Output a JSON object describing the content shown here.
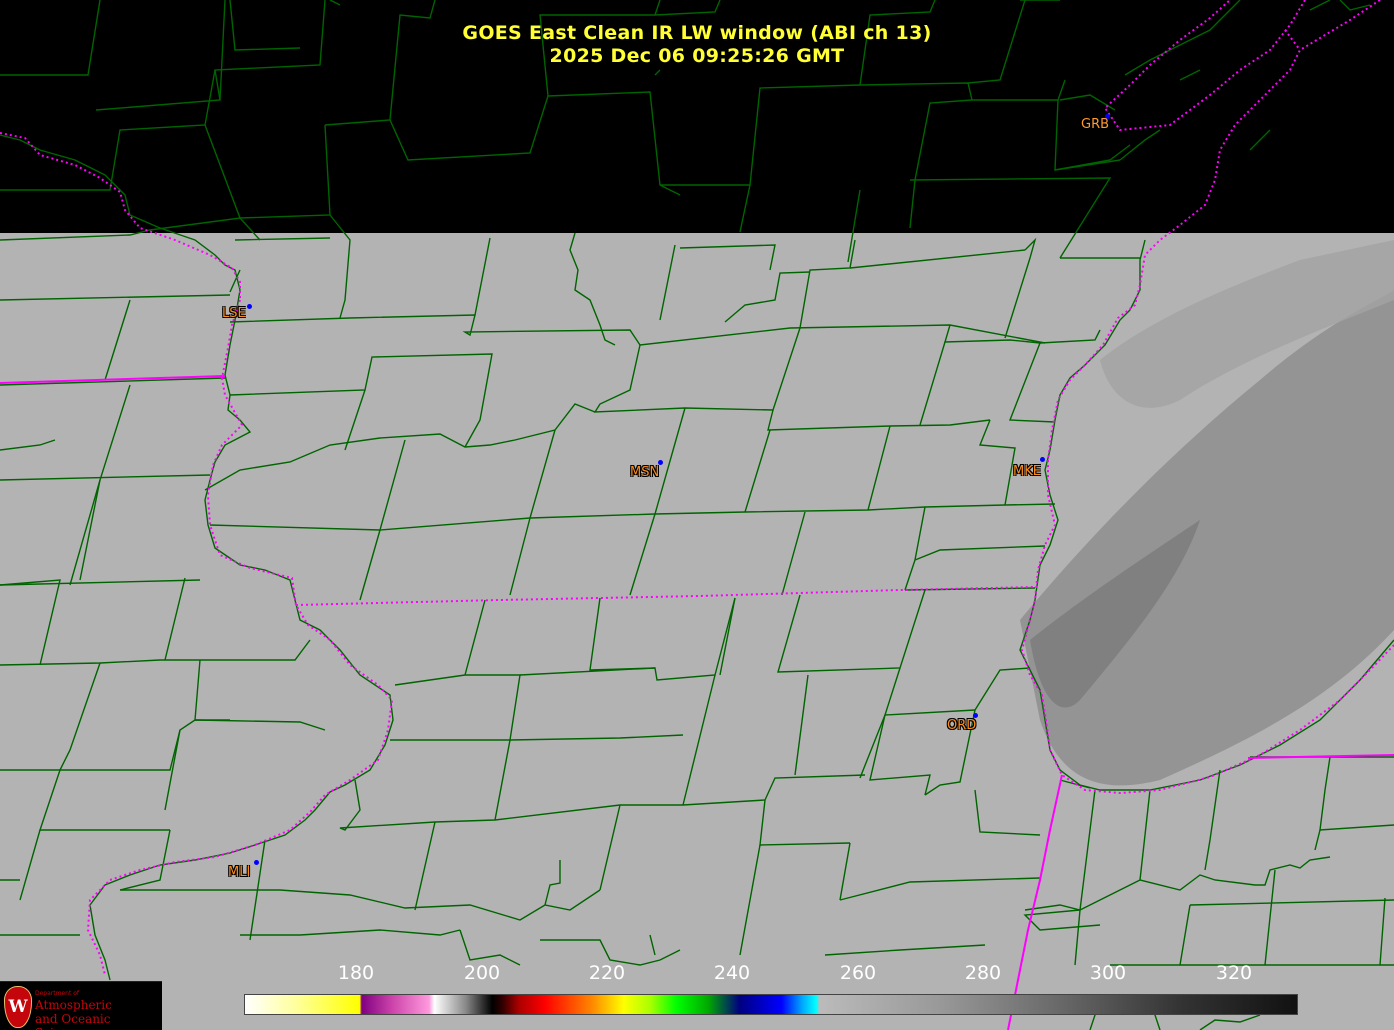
{
  "title": {
    "line1": "GOES East Clean IR LW window (ABI ch 13)",
    "line2": "2025 Dec 06  09:25:26 GMT"
  },
  "stations": [
    {
      "code": "GRB",
      "boxed": false
    },
    {
      "code": "LSE",
      "boxed": true
    },
    {
      "code": "MSN",
      "boxed": true
    },
    {
      "code": "MKE",
      "boxed": true
    },
    {
      "code": "ORD",
      "boxed": true
    },
    {
      "code": "MLI",
      "boxed": true
    }
  ],
  "colorbar": {
    "ticks": [
      "180",
      "200",
      "220",
      "240",
      "260",
      "280",
      "300",
      "320"
    ]
  },
  "logo": {
    "dept": "Department of",
    "line1": "Atmospheric",
    "line2": "and Oceanic Sciences"
  },
  "colors": {
    "title": "#ffff33",
    "county_lines": "#006400",
    "state_lines": "#ff00ff",
    "station_label": "#ff8c1a",
    "station_dot": "#0000ff"
  }
}
